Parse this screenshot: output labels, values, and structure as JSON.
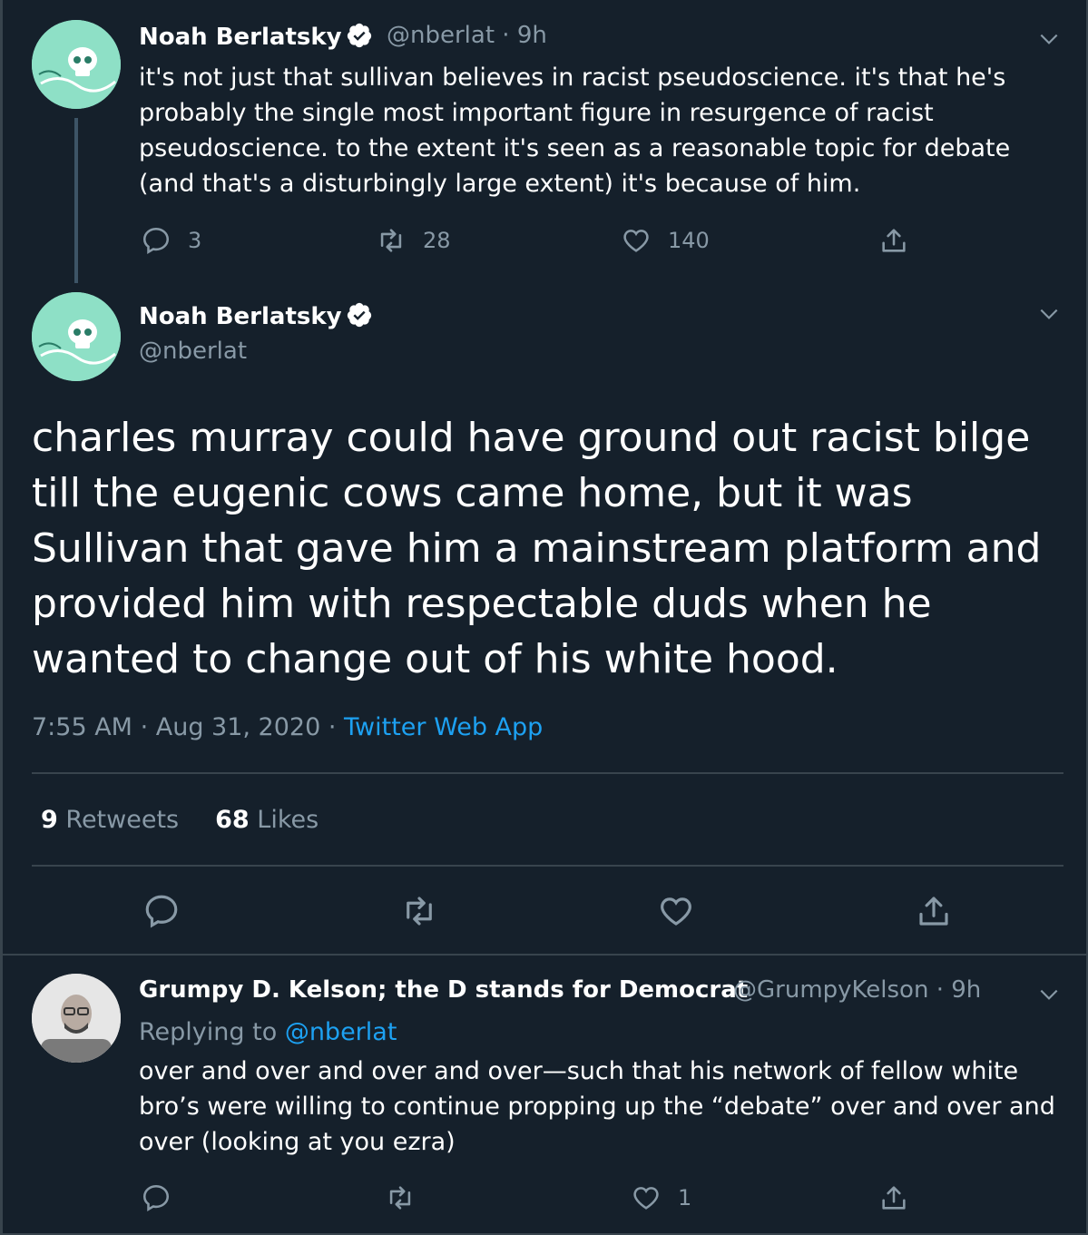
{
  "tweet1": {
    "name": "Noah Berlatsky",
    "handle": "@nberlat",
    "time": "9h",
    "text": "it's not just that sullivan believes in racist pseudoscience. it's that he's probably the single most important figure in resurgence of racist pseudoscience. to the extent it's seen as a reasonable topic for debate (and that's a disturbingly large extent) it's because of him.",
    "replies": "3",
    "retweets": "28",
    "likes": "140"
  },
  "main_tweet": {
    "name": "Noah Berlatsky",
    "handle": "@nberlat",
    "text": "charles murray could have ground out racist bilge till the eugenic cows came home, but it was Sullivan that gave him a mainstream platform and provided him with respectable duds when he wanted to change out of his white hood.",
    "time": "7:55 AM",
    "date": "Aug 31, 2020",
    "source": "Twitter Web App",
    "retweet_count": "9",
    "retweet_label": "Retweets",
    "like_count": "68",
    "like_label": "Likes"
  },
  "reply": {
    "name": "Grumpy D. Kelson; the D stands for Democrat",
    "handle": "@GrumpyKelson",
    "time": "9h",
    "replying_prefix": "Replying to",
    "replying_to": "@nberlat",
    "text": "over and over and over and over—such that his network of fellow white bro’s were willing to continue propping up the “debate” over and over and over (looking at you ezra)",
    "likes": "1"
  },
  "colors": {
    "background": "#15202b",
    "muted": "#8899a6",
    "link": "#1da1f2",
    "divider": "#38444d"
  },
  "icons": [
    "verified-icon",
    "chevron-down-icon",
    "reply-icon",
    "retweet-icon",
    "like-icon",
    "share-icon"
  ]
}
